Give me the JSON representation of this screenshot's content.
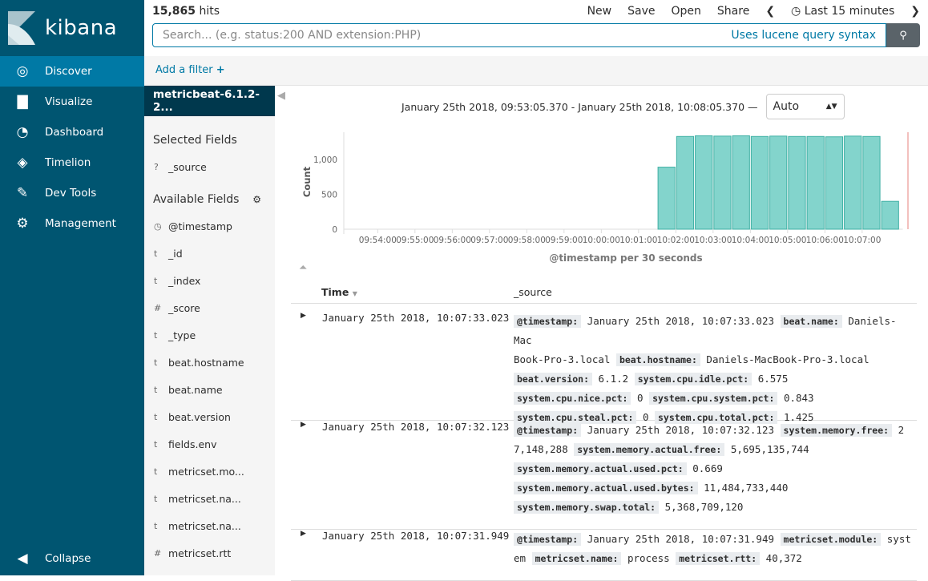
{
  "app": {
    "name": "kibana"
  },
  "nav": [
    {
      "label": "Discover",
      "icon": "compass-icon",
      "active": true
    },
    {
      "label": "Visualize",
      "icon": "bar-chart-icon"
    },
    {
      "label": "Dashboard",
      "icon": "gauge-icon"
    },
    {
      "label": "Timelion",
      "icon": "timelion-icon"
    },
    {
      "label": "Dev Tools",
      "icon": "wrench-icon"
    },
    {
      "label": "Management",
      "icon": "gear-icon"
    }
  ],
  "collapse": "Collapse",
  "top": {
    "hits_count": "15,865",
    "hits_label": "hits",
    "menu": [
      "New",
      "Save",
      "Open",
      "Share"
    ],
    "time": "Last 15 minutes"
  },
  "search": {
    "placeholder": "Search... (e.g. status:200 AND extension:PHP)",
    "lucene": "Uses lucene query syntax"
  },
  "filter": {
    "add": "Add a filter"
  },
  "fields": {
    "index": "metricbeat-6.1.2-2...",
    "selected_title": "Selected Fields",
    "selected": [
      {
        "type": "?",
        "name": "_source"
      }
    ],
    "available_title": "Available Fields",
    "available": [
      {
        "type": "clock",
        "name": "@timestamp"
      },
      {
        "type": "t",
        "name": "_id"
      },
      {
        "type": "t",
        "name": "_index"
      },
      {
        "type": "#",
        "name": "_score"
      },
      {
        "type": "t",
        "name": "_type"
      },
      {
        "type": "t",
        "name": "beat.hostname"
      },
      {
        "type": "t",
        "name": "beat.name"
      },
      {
        "type": "t",
        "name": "beat.version"
      },
      {
        "type": "t",
        "name": "fields.env"
      },
      {
        "type": "t",
        "name": "metricset.mo..."
      },
      {
        "type": "t",
        "name": "metricset.na..."
      },
      {
        "type": "t",
        "name": "metricset.na..."
      },
      {
        "type": "#",
        "name": "metricset.rtt"
      }
    ]
  },
  "range": {
    "text": "January 25th 2018, 09:53:05.370 - January 25th 2018, 10:08:05.370 —",
    "interval": "Auto"
  },
  "chart_data": {
    "type": "bar",
    "xlabel": "@timestamp per 30 seconds",
    "ylabel": "Count",
    "ylim": [
      0,
      1400
    ],
    "yticks": [
      "0",
      "500",
      "1,000"
    ],
    "xticks": [
      "09:54:00",
      "09:55:00",
      "09:56:00",
      "09:57:00",
      "09:58:00",
      "09:59:00",
      "10:00:00",
      "10:01:00",
      "10:02:00",
      "10:03:00",
      "10:04:00",
      "10:05:00",
      "10:06:00",
      "10:07:00"
    ],
    "x": [
      "10:01:30",
      "10:02:00",
      "10:02:30",
      "10:03:00",
      "10:03:30",
      "10:04:00",
      "10:04:30",
      "10:05:00",
      "10:05:30",
      "10:06:00",
      "10:06:30",
      "10:07:00",
      "10:07:30"
    ],
    "values": [
      890,
      1330,
      1340,
      1335,
      1340,
      1330,
      1335,
      1330,
      1330,
      1325,
      1335,
      1330,
      400
    ],
    "color": "#83d4cc"
  },
  "table": {
    "headers": [
      "Time",
      "_source"
    ],
    "rows": [
      {
        "time": "January 25th 2018, 10:07:33.023",
        "lines": [
          [
            [
              "@timestamp:",
              "January 25th 2018, 10:07:33.023"
            ],
            [
              "beat.name:",
              "Daniels-Mac"
            ]
          ],
          [
            [
              null,
              "Book-Pro-3.local"
            ],
            [
              "beat.hostname:",
              "Daniels-MacBook-Pro-3.local"
            ]
          ],
          [
            [
              "beat.version:",
              "6.1.2"
            ],
            [
              "system.cpu.idle.pct:",
              "6.575"
            ]
          ],
          [
            [
              "system.cpu.nice.pct:",
              "0"
            ],
            [
              "system.cpu.system.pct:",
              "0.843"
            ]
          ],
          [
            [
              "system.cpu.steal.pct:",
              "0"
            ],
            [
              "system.cpu.total.pct:",
              "1.425"
            ]
          ]
        ]
      },
      {
        "time": "January 25th 2018, 10:07:32.123",
        "lines": [
          [
            [
              "@timestamp:",
              "January 25th 2018, 10:07:32.123"
            ],
            [
              "system.memory.free:",
              "2"
            ]
          ],
          [
            [
              null,
              "7,148,288"
            ],
            [
              "system.memory.actual.free:",
              "5,695,135,744"
            ]
          ],
          [
            [
              "system.memory.actual.used.pct:",
              "0.669"
            ]
          ],
          [
            [
              "system.memory.actual.used.bytes:",
              "11,484,733,440"
            ]
          ],
          [
            [
              "system.memory.swap.total:",
              "5,368,709,120"
            ]
          ]
        ]
      },
      {
        "time": "January 25th 2018, 10:07:31.949",
        "lines": [
          [
            [
              "@timestamp:",
              "January 25th 2018, 10:07:31.949"
            ],
            [
              "metricset.module:",
              "syst"
            ]
          ],
          [
            [
              null,
              "em"
            ],
            [
              "metricset.name:",
              "process"
            ],
            [
              "metricset.rtt:",
              "40,372"
            ]
          ]
        ]
      }
    ]
  }
}
